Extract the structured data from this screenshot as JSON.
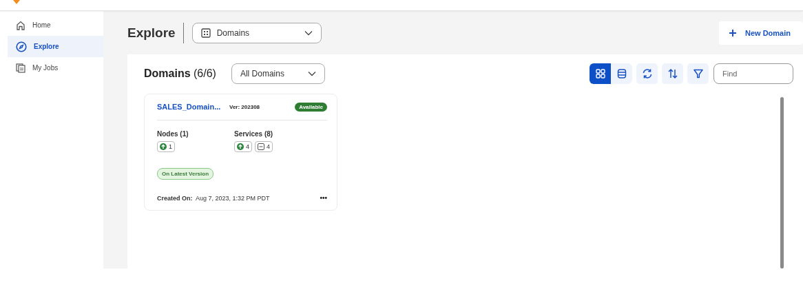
{
  "sidebar": {
    "items": [
      {
        "label": "Home",
        "kind": "home",
        "selected": false
      },
      {
        "label": "Explore",
        "kind": "explore",
        "selected": true
      },
      {
        "label": "My Jobs",
        "kind": "jobs",
        "selected": false
      }
    ]
  },
  "header": {
    "title": "Explore",
    "selector": "Domains",
    "action": "New Domain"
  },
  "panel": {
    "title": "Domains",
    "count": "(6/6)",
    "filter": "All Domains",
    "views": [
      {
        "kind": "grid",
        "selected": true
      },
      {
        "kind": "list",
        "selected": false
      }
    ],
    "tools": [
      {
        "kind": "refresh"
      },
      {
        "kind": "sort"
      },
      {
        "kind": "filter"
      }
    ],
    "search": {
      "placeholder": "Find"
    },
    "cards": [
      {
        "name": "SALES_Domain...",
        "version": "Ver: 202308",
        "status": "Available",
        "nodes": {
          "label": "Nodes (1)",
          "chips": [
            {
              "kind": "up",
              "count": "1"
            }
          ]
        },
        "services": {
          "label": "Services (8)",
          "chips": [
            {
              "kind": "up",
              "count": "4"
            },
            {
              "kind": "disabled",
              "count": "4"
            }
          ]
        },
        "tag": "On Latest Version",
        "created_label": "Created On:",
        "created": "Aug 7, 2023, 1:32 PM PDT",
        "menu": "•••"
      }
    ]
  }
}
